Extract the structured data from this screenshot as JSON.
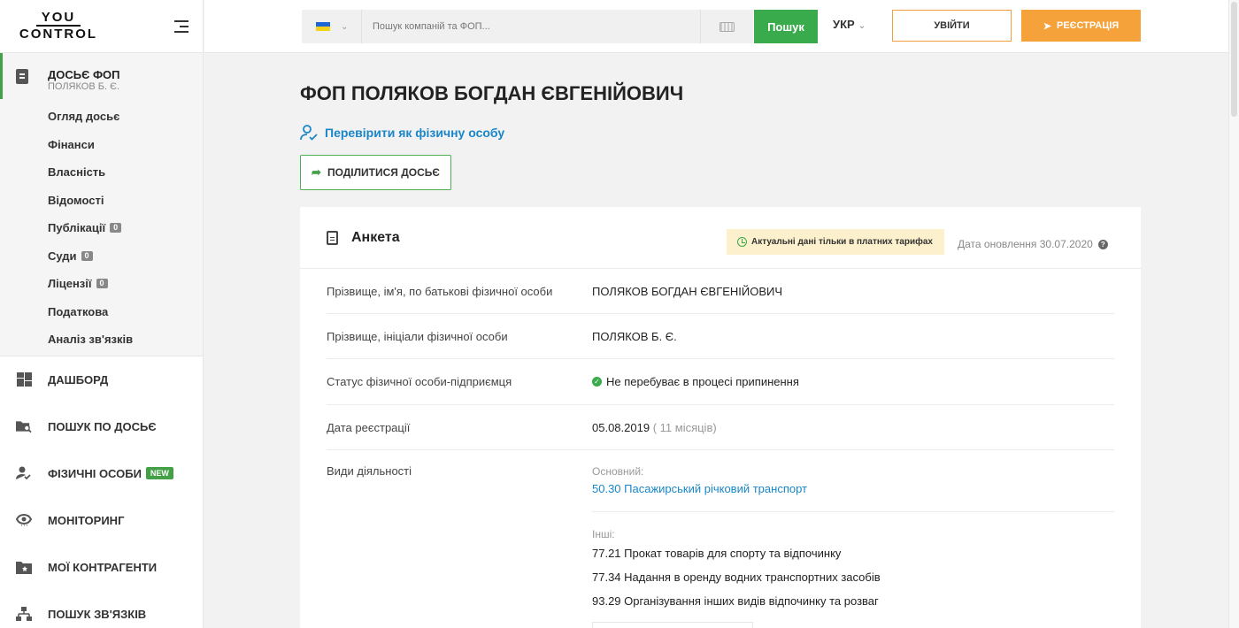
{
  "logo": {
    "top": "YOU",
    "bottom": "CONTROL"
  },
  "sidebar": {
    "dossier": {
      "title": "ДОСЬЄ ФОП",
      "subtitle": "ПОЛЯКОВ Б. Є."
    },
    "sub_items": [
      {
        "label": "Огляд досьє"
      },
      {
        "label": "Фінанси"
      },
      {
        "label": "Власність"
      },
      {
        "label": "Відомості"
      },
      {
        "label": "Публікації",
        "badge": "0"
      },
      {
        "label": "Суди",
        "badge": "0"
      },
      {
        "label": "Ліцензії",
        "badge": "0"
      },
      {
        "label": "Податкова"
      },
      {
        "label": "Аналіз зв'язків"
      }
    ],
    "nav": [
      {
        "label": "ДАШБОРД",
        "icon": "dashboard-icon"
      },
      {
        "label": "ПОШУК ПО ДОСЬЄ",
        "icon": "folder-search-icon"
      },
      {
        "label": "ФІЗИЧНІ ОСОБИ",
        "icon": "person-check-icon",
        "badge": "NEW"
      },
      {
        "label": "МОНІТОРИНГ",
        "icon": "eye-icon"
      },
      {
        "label": "МОЇ КОНТРАГЕНТИ",
        "icon": "folder-star-icon"
      },
      {
        "label": "ПОШУК ЗВ'ЯЗКІВ",
        "icon": "hierarchy-icon"
      }
    ]
  },
  "topbar": {
    "search_placeholder": "Пошук компаній та ФОП...",
    "search_button": "Пошук",
    "language": "УКР",
    "login": "УВІЙТИ",
    "register": "РЕЄСТРАЦІЯ"
  },
  "main": {
    "title": "ФОП ПОЛЯКОВ БОГДАН ЄВГЕНІЙОВИЧ",
    "check_link": "Перевірити як фізичну особу",
    "share_button": "ПОДІЛИТИСЯ ДОСЬЄ"
  },
  "card": {
    "title": "Анкета",
    "paid_notice": "Актуальні дані тільки в платних тарифах",
    "update_date": "Дата оновлення 30.07.2020",
    "rows": [
      {
        "label": "Прізвище, ім'я, по батькові фізичної особи",
        "value": "ПОЛЯКОВ БОГДАН ЄВГЕНІЙОВИЧ"
      },
      {
        "label": "Прізвище, ініціали фізичної особи",
        "value": "ПОЛЯКОВ Б. Є."
      },
      {
        "label": "Статус фізичної особи-підприємця",
        "value": "Не перебуває в процесі припинення"
      },
      {
        "label": "Дата реєстрації",
        "value": "05.08.2019",
        "extra": "( 11 місяців)"
      }
    ],
    "activities": {
      "label": "Види діяльності",
      "main_label": "Основний:",
      "main": "50.30 Пасажирський річковий транспорт",
      "other_label": "Інші:",
      "other": [
        "77.21 Прокат товарів для спорту та відпочинку",
        "77.34 Надання в оренду водних транспортних засобів",
        "93.29 Організування інших видів відпочинку та розваг"
      ]
    }
  },
  "colors": {
    "accent_green": "#3aab4c",
    "accent_orange": "#f5a23a",
    "link_blue": "#1a86c8"
  }
}
